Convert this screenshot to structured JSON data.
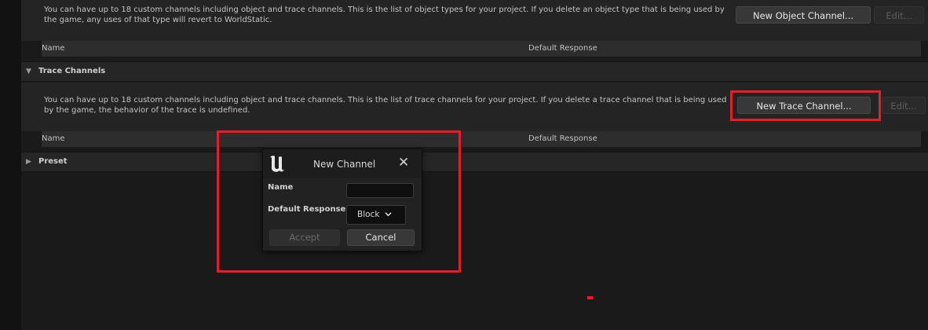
{
  "object_channels": {
    "description": "You can have up to 18 custom channels including object and trace channels. This is the list of object types for your project. If you delete an object type that is being used by the game, any uses of that type will revert to WorldStatic.",
    "new_button": "New Object Channel...",
    "edit_button": "Edit...",
    "col_name": "Name",
    "col_default_response": "Default Response"
  },
  "trace_channels": {
    "title": "Trace Channels",
    "description": "You can have up to 18 custom channels including object and trace channels. This is the list of trace channels for your project. If you delete a trace channel that is being used by the game, the behavior of the trace is undefined.",
    "new_button": "New Trace Channel...",
    "edit_button": "Edit...",
    "col_name": "Name",
    "col_default_response": "Default Response"
  },
  "preset": {
    "title": "Preset"
  },
  "dialog": {
    "title": "New Channel",
    "name_label": "Name",
    "name_value": "",
    "default_response_label": "Default Response",
    "default_response_value": "Block",
    "accept_button": "Accept",
    "cancel_button": "Cancel"
  },
  "icons": {
    "collapse": "triangle-down-icon",
    "expand": "triangle-right-icon",
    "close": "close-icon",
    "dropdown": "chevron-down-icon",
    "logo": "unreal-logo-icon"
  },
  "colors": {
    "highlight": "#e0202a",
    "panel_bg": "#1a1a1a",
    "button_bg": "#383838"
  }
}
